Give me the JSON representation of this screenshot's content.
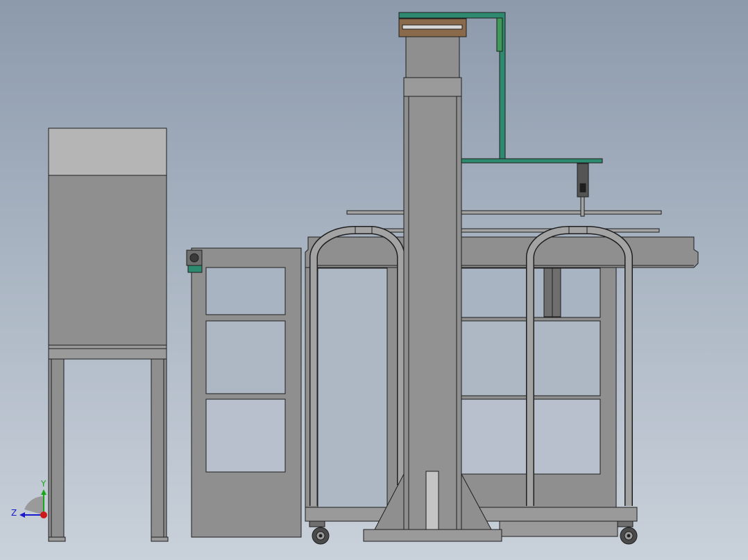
{
  "viewport": {
    "background_top": "#8c9aac",
    "background_bottom": "#c9d1da"
  },
  "triad": {
    "y_label": "Y",
    "z_label": "Z",
    "y_color": "#1aa51a",
    "z_color": "#1a1acc",
    "x_color": "#cc1a1a"
  },
  "model": {
    "part_fill": "#8f8f8f",
    "part_fill_light": "#a3a3a3",
    "edge_color": "#1e1e1e",
    "bracket_color": "#2e8a6e",
    "clamp_color": "#8a6a4a",
    "cabinet_top_color": "#b5b5b5"
  }
}
